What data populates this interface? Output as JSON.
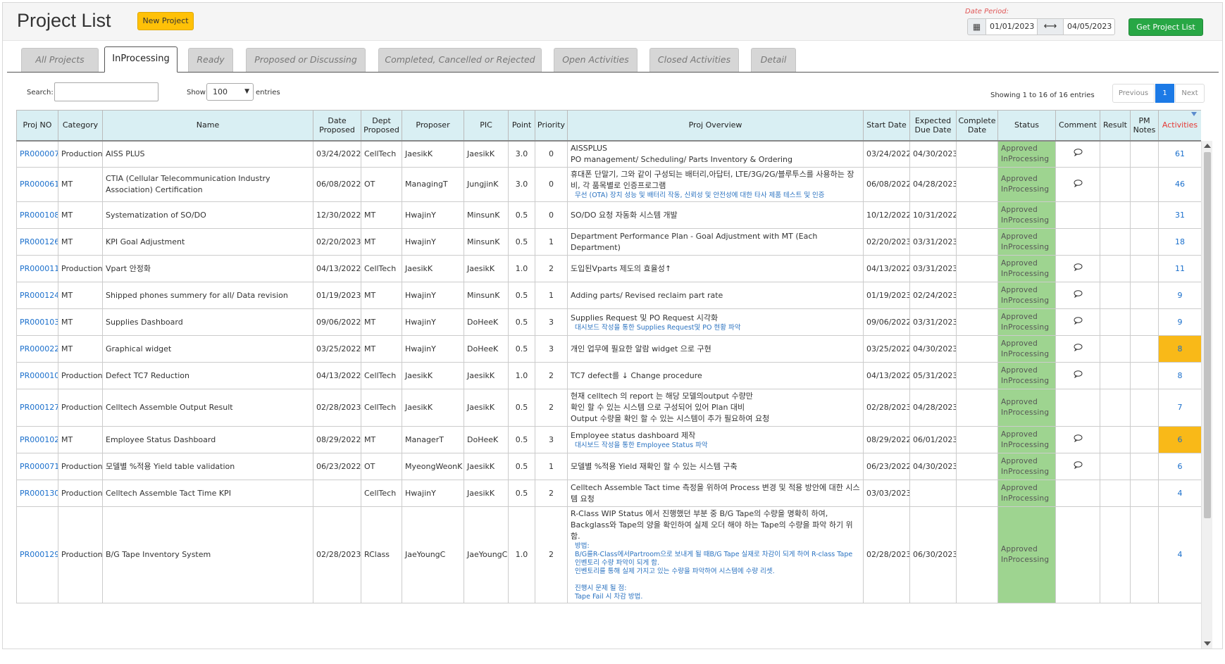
{
  "header": {
    "title": "Project List",
    "new_project_label": "New Project",
    "date_period_label": "Date Period:",
    "date_from": "01/01/2023",
    "date_to": "04/05/2023",
    "get_list_label": "Get Project List",
    "calendar_icon": "calendar-icon",
    "range_icon": "double-arrow-icon"
  },
  "tabs": [
    {
      "label": "All Projects",
      "active": false
    },
    {
      "label": "InProcessing",
      "active": true
    },
    {
      "label": "Ready",
      "active": false
    },
    {
      "label": "Proposed or Discussing",
      "active": false
    },
    {
      "label": "Completed, Cancelled or Rejected",
      "active": false
    },
    {
      "label": "Open Activities",
      "active": false
    },
    {
      "label": "Closed Activities",
      "active": false
    },
    {
      "label": "Detail",
      "active": false
    }
  ],
  "controls": {
    "search_label": "Search:",
    "search_value": "",
    "show_label": "Show",
    "entries_value": "100",
    "entries_label": "entries",
    "showing_info": "Showing 1 to 16 of 16 entries",
    "pager_prev": "Previous",
    "pager_current": "1",
    "pager_next": "Next"
  },
  "columns": {
    "proj_no": "Proj NO",
    "category": "Category",
    "name": "Name",
    "date_proposed": "Date Proposed",
    "dept_proposed": "Dept Proposed",
    "proposer": "Proposer",
    "pic": "PIC",
    "point": "Point",
    "priority": "Priority",
    "overview": "Proj Overview",
    "start_date": "Start Date",
    "due_date": "Expected Due Date",
    "complete_date": "Complete Date",
    "status": "Status",
    "comment": "Comment",
    "result": "Result",
    "pm_notes": "PM Notes",
    "activities": "Activities"
  },
  "colors": {
    "status_bg": "#9ed490",
    "activity_highlight": "#f9b918",
    "link": "#1a6fcc",
    "accent_green": "#28a745",
    "accent_yellow": "#ffc107"
  },
  "rows": [
    {
      "id": "PR000007",
      "category": "Production",
      "name": "AISS PLUS",
      "date_proposed": "03/24/2022",
      "dept": "CellTech",
      "proposer": "JaesikK",
      "pic": "JaesikK",
      "point": "3.0",
      "priority": "0",
      "overview": [
        "AISSPLUS",
        "PO management/ Scheduling/ Parts Inventory & Ordering"
      ],
      "overview_sub": [],
      "start": "03/24/2022",
      "due": "04/30/2023",
      "complete": "",
      "status1": "Approved",
      "status2": "InProcessing",
      "comment": true,
      "activities": "61",
      "highlight": false
    },
    {
      "id": "PR000061",
      "category": "MT",
      "name": "CTIA (Cellular Telecommunication Industry Association) Certification",
      "date_proposed": "06/08/2022",
      "dept": "OT",
      "proposer": "ManagingT",
      "pic": "JungjinK",
      "point": "3.0",
      "priority": "0",
      "overview": [
        "휴대폰 단말기, 그와 같이 구성되는 배터리,아답터, LTE/3G/2G/블루투스를 사용하는 장비, 각 품목별로 인증프로그램"
      ],
      "overview_sub": [
        "무선 (OTA) 장치 성능 및 배터리 작동, 신뢰성 및 안전성에 대한 타사 제품 테스트 및 인증"
      ],
      "start": "06/08/2022",
      "due": "04/28/2023",
      "complete": "",
      "status1": "Approved",
      "status2": "InProcessing",
      "comment": true,
      "activities": "46",
      "highlight": false
    },
    {
      "id": "PR000108",
      "category": "MT",
      "name": "Systematization of SO/DO",
      "date_proposed": "12/30/2022",
      "dept": "MT",
      "proposer": "HwajinY",
      "pic": "MinsunK",
      "point": "0.5",
      "priority": "0",
      "overview": [
        "SO/DO 요청 자동화 시스템 개발"
      ],
      "overview_sub": [],
      "start": "10/12/2022",
      "due": "10/31/2022",
      "complete": "",
      "status1": "Approved",
      "status2": "InProcessing",
      "comment": false,
      "activities": "31",
      "highlight": false
    },
    {
      "id": "PR000126",
      "category": "MT",
      "name": "KPI Goal Adjustment",
      "date_proposed": "02/20/2023",
      "dept": "MT",
      "proposer": "HwajinY",
      "pic": "MinsunK",
      "point": "0.5",
      "priority": "1",
      "overview": [
        "Department Performance Plan - Goal Adjustment with MT (Each Department)"
      ],
      "overview_sub": [],
      "start": "02/20/2023",
      "due": "03/31/2023",
      "complete": "",
      "status1": "Approved",
      "status2": "InProcessing",
      "comment": false,
      "activities": "18",
      "highlight": false
    },
    {
      "id": "PR000011",
      "category": "Production",
      "name": "Vpart 안정화",
      "date_proposed": "04/13/2022",
      "dept": "CellTech",
      "proposer": "JaesikK",
      "pic": "JaesikK",
      "point": "1.0",
      "priority": "2",
      "overview": [
        "도입된Vparts 제도의 효율성↑"
      ],
      "overview_sub": [],
      "start": "04/13/2022",
      "due": "03/31/2023",
      "complete": "",
      "status1": "Approved",
      "status2": "InProcessing",
      "comment": true,
      "activities": "11",
      "highlight": false
    },
    {
      "id": "PR000124",
      "category": "MT",
      "name": "Shipped phones summery for all/ Data revision",
      "date_proposed": "01/19/2023",
      "dept": "MT",
      "proposer": "HwajinY",
      "pic": "MinsunK",
      "point": "0.5",
      "priority": "1",
      "overview": [
        "Adding parts/ Revised reclaim part rate"
      ],
      "overview_sub": [],
      "start": "01/19/2023",
      "due": "02/24/2023",
      "complete": "",
      "status1": "Approved",
      "status2": "InProcessing",
      "comment": true,
      "activities": "9",
      "highlight": false
    },
    {
      "id": "PR000103",
      "category": "MT",
      "name": "Supplies Dashboard",
      "date_proposed": "09/06/2022",
      "dept": "MT",
      "proposer": "HwajinY",
      "pic": "DoHeeK",
      "point": "0.5",
      "priority": "3",
      "overview": [
        "Supplies Request 및 PO Request 시각화"
      ],
      "overview_sub": [
        "대시보드 작성을 통한 Supplies Request및 PO 현황 파악"
      ],
      "start": "09/06/2022",
      "due": "03/31/2023",
      "complete": "",
      "status1": "Approved",
      "status2": "InProcessing",
      "comment": true,
      "activities": "9",
      "highlight": false
    },
    {
      "id": "PR000022",
      "category": "MT",
      "name": "Graphical widget",
      "date_proposed": "03/25/2022",
      "dept": "MT",
      "proposer": "HwajinY",
      "pic": "DoHeeK",
      "point": "0.5",
      "priority": "3",
      "overview": [
        "개인 업무에 필요한 알람 widget 으로 구현"
      ],
      "overview_sub": [],
      "start": "03/25/2022",
      "due": "04/30/2023",
      "complete": "",
      "status1": "Approved",
      "status2": "InProcessing",
      "comment": true,
      "activities": "8",
      "highlight": true
    },
    {
      "id": "PR000010",
      "category": "Production",
      "name": "Defect TC7 Reduction",
      "date_proposed": "04/13/2022",
      "dept": "CellTech",
      "proposer": "JaesikK",
      "pic": "JaesikK",
      "point": "1.0",
      "priority": "2",
      "overview": [
        "TC7 defect를 ↓ Change procedure"
      ],
      "overview_sub": [],
      "start": "04/13/2022",
      "due": "05/31/2023",
      "complete": "",
      "status1": "Approved",
      "status2": "InProcessing",
      "comment": true,
      "activities": "8",
      "highlight": false
    },
    {
      "id": "PR000127",
      "category": "Production",
      "name": "Celltech Assemble Output Result",
      "date_proposed": "02/28/2023",
      "dept": "CellTech",
      "proposer": "JaesikK",
      "pic": "JaesikK",
      "point": "0.5",
      "priority": "2",
      "overview": [
        "현재 celltech 의 report 는 해당 모델의output 수량만",
        "확인 할 수 있는 시스템 으로 구성되어 있어 Plan 대비",
        "Output 수량을 확인 할 수 있는 시스템이 추가 필요하여 요청"
      ],
      "overview_sub": [],
      "start": "02/28/2023",
      "due": "04/28/2023",
      "complete": "",
      "status1": "Approved",
      "status2": "InProcessing",
      "comment": false,
      "activities": "7",
      "highlight": false
    },
    {
      "id": "PR000102",
      "category": "MT",
      "name": "Employee Status Dashboard",
      "date_proposed": "08/29/2022",
      "dept": "MT",
      "proposer": "ManagerT",
      "pic": "DoHeeK",
      "point": "0.5",
      "priority": "3",
      "overview": [
        "Employee status dashboard 제작"
      ],
      "overview_sub": [
        "대시보드 작성을 통한 Employee Status 파악"
      ],
      "start": "08/29/2022",
      "due": "06/01/2023",
      "complete": "",
      "status1": "Approved",
      "status2": "InProcessing",
      "comment": true,
      "activities": "6",
      "highlight": true
    },
    {
      "id": "PR000071",
      "category": "Production",
      "name": "모델별 %적용 Yield table validation",
      "date_proposed": "06/23/2022",
      "dept": "OT",
      "proposer": "MyeongWeonK",
      "pic": "JaesikK",
      "point": "0.5",
      "priority": "1",
      "overview": [
        "모델별 %적용 Yield 재확인 할 수 있는 시스템 구축"
      ],
      "overview_sub": [],
      "start": "06/23/2022",
      "due": "04/30/2023",
      "complete": "",
      "status1": "Approved",
      "status2": "InProcessing",
      "comment": true,
      "activities": "6",
      "highlight": false
    },
    {
      "id": "PR000130",
      "category": "Production",
      "name": "Celltech Assemble Tact Time KPI",
      "date_proposed": "",
      "dept": "CellTech",
      "proposer": "HwajinY",
      "pic": "JaesikK",
      "point": "0.5",
      "priority": "2",
      "overview": [
        "Celltech Assemble Tact time 측정을 위하여 Process 변경 및 적용 방안에 대한 시스템 요청"
      ],
      "overview_sub": [],
      "start": "03/03/2023",
      "due": "",
      "complete": "",
      "status1": "Approved",
      "status2": "InProcessing",
      "comment": false,
      "activities": "4",
      "highlight": false
    },
    {
      "id": "PR000129",
      "category": "Production",
      "name": "B/G Tape Inventory System",
      "date_proposed": "02/28/2023",
      "dept": "RClass",
      "proposer": "JaeYoungC",
      "pic": "JaeYoungC",
      "point": "1.0",
      "priority": "2",
      "overview": [
        "R-Class WIP Status 에서 진행했던 부분 중 B/G Tape의 수량을 명확히 하여, Backglass와 Tape의 양을 확인하여 실제 오더 해야 하는 Tape의 수량을 파악 하기 위함."
      ],
      "overview_sub": [
        "방법:",
        "B/G를R-Class에서Partroom으로 보내게 될 때B/G Tape 실재로 차감이 되게 하여 R-class Tape 인벤토리 수량 파악이 되게 함.",
        "인벤토리를 통해 실제 가지고 있는 수량을 파악하여 시스템에 수량 리셋.",
        "",
        "진행시 문제 될 점:",
        "Tape Fail 시 차감 방법."
      ],
      "start": "02/28/2023",
      "due": "06/30/2023",
      "complete": "",
      "status1": "Approved",
      "status2": "InProcessing",
      "comment": false,
      "activities": "4",
      "highlight": false
    }
  ]
}
